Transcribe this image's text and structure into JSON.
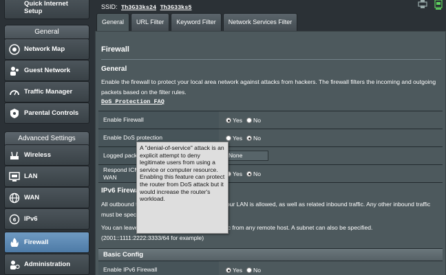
{
  "sidebar": {
    "quick_setup": "Quick Internet Setup",
    "general_header": "General",
    "general_items": [
      {
        "label": "Network Map",
        "icon": "network-map-icon"
      },
      {
        "label": "Guest Network",
        "icon": "guest-network-icon"
      },
      {
        "label": "Traffic Manager",
        "icon": "traffic-manager-icon"
      },
      {
        "label": "Parental Controls",
        "icon": "parental-controls-icon"
      }
    ],
    "advanced_header": "Advanced Settings",
    "advanced_items": [
      {
        "label": "Wireless",
        "icon": "wireless-icon"
      },
      {
        "label": "LAN",
        "icon": "lan-icon"
      },
      {
        "label": "WAN",
        "icon": "wan-icon"
      },
      {
        "label": "IPv6",
        "icon": "ipv6-icon"
      },
      {
        "label": "Firewall",
        "icon": "firewall-icon",
        "active": true
      },
      {
        "label": "Administration",
        "icon": "administration-icon"
      }
    ]
  },
  "topbar": {
    "ssid_label": "SSID:",
    "ssid_1": "Th3G33ks24",
    "ssid_2": "Th3G33ks5"
  },
  "tabs": [
    "General",
    "URL Filter",
    "Keyword Filter",
    "Network Services Filter"
  ],
  "content": {
    "title": "Firewall",
    "section": "General",
    "description": "Enable the firewall to protect your local area network against attacks from hackers. The firewall filters the incoming and outgoing packets based on the filter rules.",
    "faq_link": "DoS Protection FAQ",
    "rows": [
      {
        "label": "Enable Firewall",
        "yes": "Yes",
        "no": "No"
      },
      {
        "label": "Enable DoS protection",
        "yes": "Yes",
        "no": "No"
      },
      {
        "label": "Logged packets type",
        "value": "None"
      },
      {
        "label": "Respond ICMP Echo (ping) Request from WAN",
        "yes": "Yes",
        "no": "No"
      }
    ],
    "ipv6_title": "IPv6 Firewall",
    "ipv6_text_1": "All outbound traffic coming from IPv6 hosts on your LAN is allowed, as well as related inbound traffic. Any other inbound traffic must be specifically allowed here.",
    "ipv6_text_2": "You can leave the remote IP empty to allow traffic from any remote host. A subnet can also be specified.",
    "ipv6_example": "(2001::1111:2222:3333/64 for example)",
    "basic_config": "Basic Config",
    "ipv6_row": {
      "label": "Enable IPv6 Firewall",
      "yes": "Yes",
      "no": "No"
    }
  },
  "tooltip": "A \"denial-of-service\" attack is an explicit attempt to deny legitimate users from using a service or computer resource. Enabling this feature can protect the router from DoS attack but it would increase the router's workload."
}
